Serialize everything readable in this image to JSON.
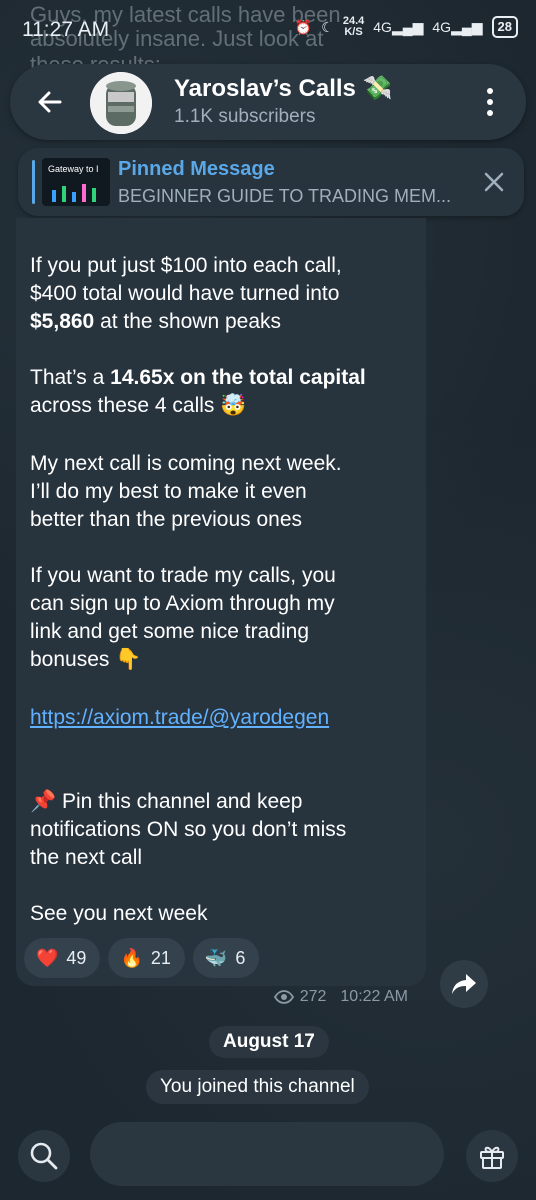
{
  "status_bar": {
    "time": "11:27 AM",
    "netspeed_value": "24.4",
    "netspeed_unit": "K/S",
    "network1": "4G",
    "network2": "4G",
    "battery": "28"
  },
  "background_text": {
    "line1": "Guys, my latest calls have been",
    "line2": "absolutely insane. Just look at",
    "line3": "these results:"
  },
  "header": {
    "title": "Yaroslav’s Calls 💸",
    "subtitle": "1.1K subscribers"
  },
  "pinned": {
    "title": "Pinned Message",
    "text": "BEGINNER GUIDE TO TRADING MEM...",
    "thumb_text": "Gateway to I"
  },
  "message": {
    "p1_a": "If you put just $100 into each call,",
    "p1_b": "$400 total would have turned into",
    "p1_bold": "$5,860",
    "p1_c": " at the shown peaks",
    "p2_a": "That’s a ",
    "p2_bold": "14.65x on the total capital",
    "p2_b": "across these 4 calls 🤯",
    "p3_a": "My next call is coming next week.",
    "p3_b": "I’ll do my best to make it even",
    "p3_c": "better than the previous ones",
    "p4_a": "If you want to trade my calls, you",
    "p4_b": "can sign up to Axiom through my",
    "p4_c": "link and get some nice trading",
    "p4_d": "bonuses 👇",
    "link": "https://axiom.trade/@yarodegen",
    "p5_a": "📌 Pin this channel and keep",
    "p5_b": "notifications ON so you don’t miss",
    "p5_c": "the next call",
    "p6": "See you next week"
  },
  "reactions": [
    {
      "emoji": "❤️",
      "count": "49"
    },
    {
      "emoji": "🔥",
      "count": "21"
    },
    {
      "emoji": "🐳",
      "count": "6"
    }
  ],
  "meta": {
    "views": "272",
    "time": "10:22 AM"
  },
  "service": {
    "date": "August 17",
    "joined": "You joined this channel"
  },
  "colors": {
    "accent": "#5aa8e8",
    "link": "#62b1ff",
    "bubble": "#27333d"
  }
}
